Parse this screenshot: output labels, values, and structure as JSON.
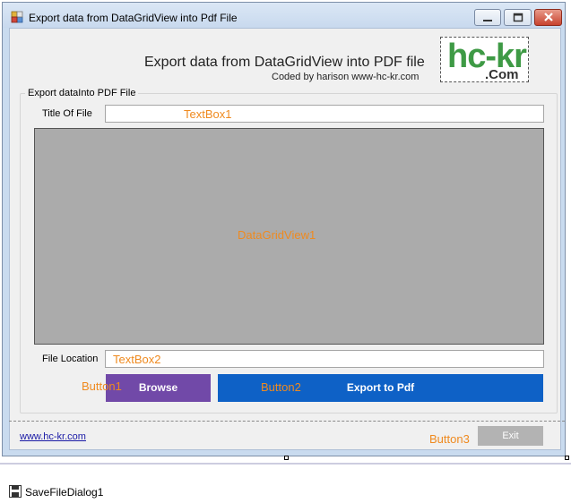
{
  "window": {
    "title": "Export data from DataGridView into Pdf File"
  },
  "header": {
    "title": "Export data from DataGridView into PDF file",
    "subtitle": "Coded by harison www-hc-kr.com",
    "logo_main": "hc-kr",
    "logo_sub": ".Com"
  },
  "group": {
    "label": "Export dataInto PDF File"
  },
  "title_field": {
    "label": "Title Of File",
    "designer_name": "TextBox1",
    "value": ""
  },
  "grid": {
    "designer_name": "DataGridView1"
  },
  "location_field": {
    "label": "File Location",
    "designer_name": "TextBox2",
    "value": ""
  },
  "browse_button": {
    "label": "Browse",
    "designer_name": "Button1",
    "color": "#7149a8"
  },
  "export_button": {
    "label": "Export to Pdf",
    "designer_name": "Button2",
    "color": "#0e61c6"
  },
  "footer": {
    "link_text": "www.hc-kr.com"
  },
  "exit_button": {
    "label": "Exit",
    "designer_name": "Button3"
  },
  "component_tray": {
    "items": [
      {
        "name": "SaveFileDialog1",
        "icon": "save-dialog-icon"
      }
    ]
  },
  "colors": {
    "accent_orange": "#ef8a1f",
    "logo_green": "#3e9a45",
    "grid_gray": "#ababab"
  }
}
